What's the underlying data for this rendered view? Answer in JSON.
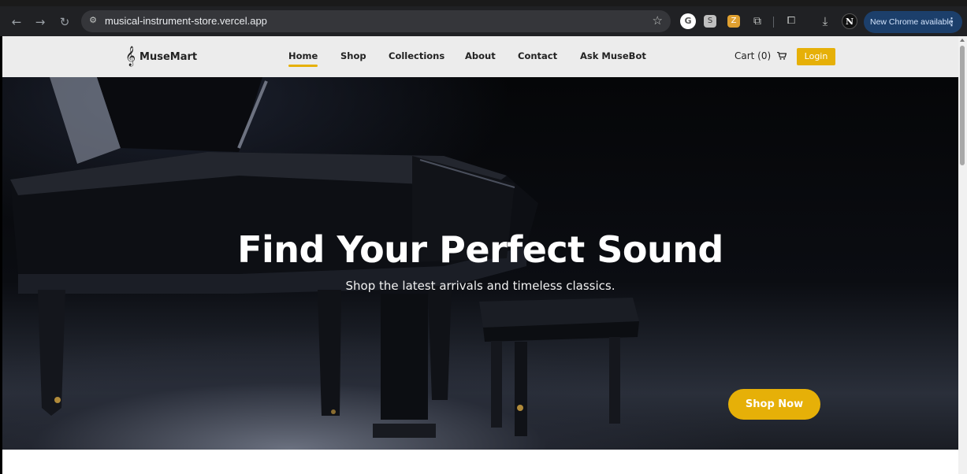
{
  "browser": {
    "url": "musical-instrument-store.vercel.app",
    "update_label": "New Chrome available",
    "icons": [
      "back-arrow-icon",
      "forward-arrow-icon",
      "reload-icon",
      "site-info-icon",
      "bookmark-star-icon",
      "extensions-puzzle-icon",
      "download-icon",
      "kebab-menu-icon"
    ]
  },
  "header": {
    "brand": "MuseMart",
    "logo_icon": "treble-clef-icon",
    "nav": [
      "Home",
      "Shop",
      "Collections",
      "About",
      "Contact",
      "Ask MuseBot"
    ],
    "active_nav": "Home",
    "cart_label": "Cart (0)",
    "cart_icon": "shopping-cart-icon",
    "login_label": "Login"
  },
  "hero": {
    "title": "Find Your Perfect Sound",
    "subtitle": "Shop the latest arrivals and timeless classics.",
    "cta_label": "Shop Now"
  },
  "colors": {
    "accent": "#e6b008",
    "header_bg": "#ececec",
    "chrome_bg": "#202124"
  }
}
